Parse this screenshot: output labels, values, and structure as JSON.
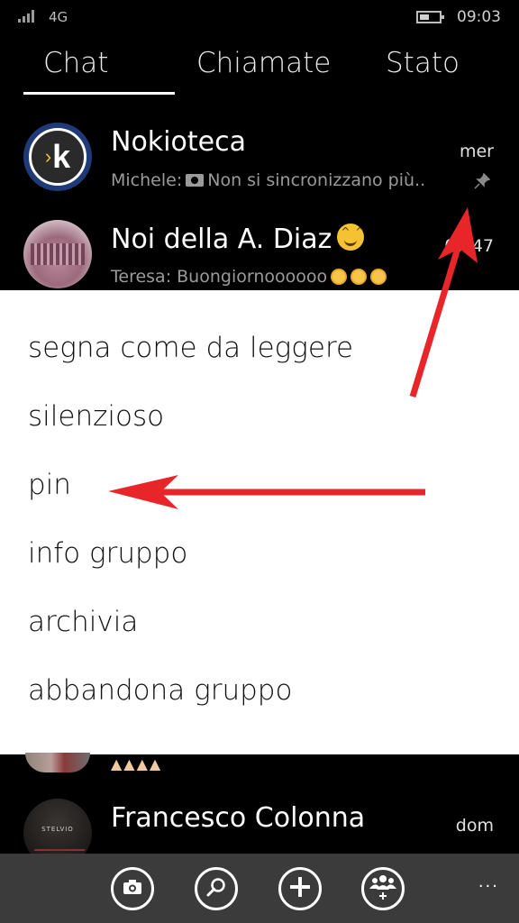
{
  "status_bar": {
    "network": "4G",
    "time": "09:03",
    "signal_bars": 4,
    "battery_level_percent": 40
  },
  "tabs": [
    {
      "label": "Chat",
      "active": true
    },
    {
      "label": "Chiamate",
      "active": false
    },
    {
      "label": "Stato",
      "active": false
    }
  ],
  "chats": [
    {
      "name": "Nokioteca",
      "sender": "Michele:",
      "preview": "Non si sincronizzano più..",
      "time": "mer",
      "pinned": true,
      "avatar_letter": "k"
    },
    {
      "name": "Noi della A. Diaz",
      "sender": "Teresa:",
      "preview": "Buongiornoooooo",
      "time": "07:47"
    },
    {
      "name": "Francesco Colonna",
      "time": "dom",
      "avatar_brand": "STELVIO"
    }
  ],
  "context_menu": {
    "items": [
      "segna come da leggere",
      "silenzioso",
      "pin",
      "info gruppo",
      "archivia",
      "abbandona gruppo"
    ]
  },
  "app_bar": {
    "buttons": [
      {
        "icon": "camera-icon"
      },
      {
        "icon": "search-icon"
      },
      {
        "icon": "plus-icon"
      },
      {
        "icon": "new-group-icon"
      }
    ],
    "more": "···"
  },
  "colors": {
    "annotation_red": "#e8262a",
    "app_bar_bg": "#3b3b3b",
    "menu_bg": "#ffffff"
  }
}
